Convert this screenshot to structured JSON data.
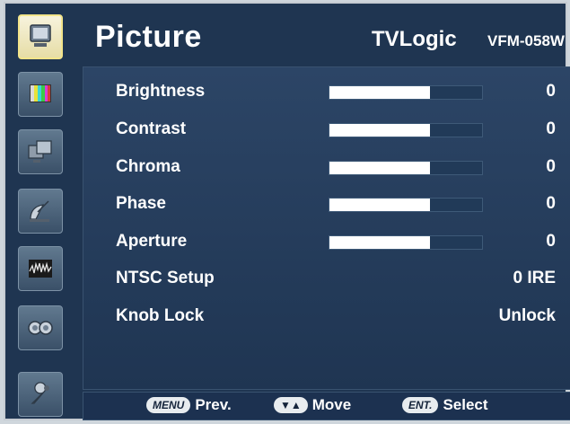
{
  "header": {
    "title": "Picture",
    "brand": "TVLogic",
    "model": "VFM-058W"
  },
  "sidebar": {
    "items": [
      {
        "icon": "monitor-icon",
        "active": true
      },
      {
        "icon": "color-bars-icon",
        "active": false
      },
      {
        "icon": "multi-screen-icon",
        "active": false
      },
      {
        "icon": "satellite-dish-icon",
        "active": false
      },
      {
        "icon": "waveform-icon",
        "active": false
      },
      {
        "icon": "audio-speakers-icon",
        "active": false
      },
      {
        "icon": "wrench-icon",
        "active": false
      }
    ]
  },
  "menu": {
    "rows": [
      {
        "label": "Brightness",
        "value": "0",
        "bar": 0.66
      },
      {
        "label": "Contrast",
        "value": "0",
        "bar": 0.66
      },
      {
        "label": "Chroma",
        "value": "0",
        "bar": 0.66
      },
      {
        "label": "Phase",
        "value": "0",
        "bar": 0.66
      },
      {
        "label": "Aperture",
        "value": "0",
        "bar": 0.66
      },
      {
        "label": "NTSC Setup",
        "value": "0 IRE"
      },
      {
        "label": "Knob Lock",
        "value": "Unlock"
      }
    ]
  },
  "footer": {
    "menu_key": "MENU",
    "menu_label": "Prev.",
    "move_label": "Move",
    "enter_key": "ENT.",
    "enter_label": "Select"
  },
  "colors": {
    "background": "#1f3551",
    "active_tab": "#f2e48a",
    "bar_fill": "#ffffff"
  }
}
